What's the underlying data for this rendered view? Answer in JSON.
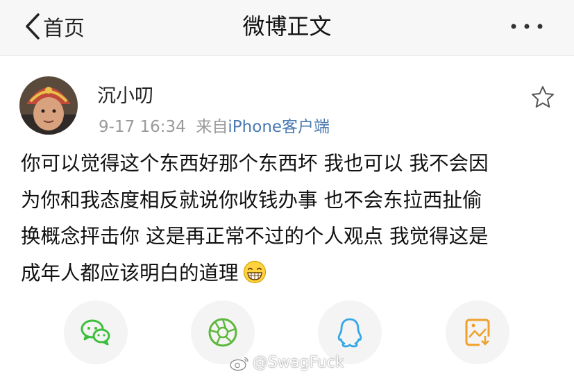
{
  "nav": {
    "back_label": "首页",
    "title": "微博正文"
  },
  "post": {
    "username": "沉小叨",
    "date": "9-17 16:34",
    "source_prefix": "来自",
    "source": "iPhone客户端",
    "lines": [
      "你可以觉得这个东西好那个东西坏 我也可以 我不会因",
      "为你和我态度相反就说你收钱办事 也不会东拉西扯偷",
      "换概念抨击你 这是再正常不过的个人观点 我觉得这是",
      "成年人都应该明白的道理"
    ]
  },
  "share_icons": [
    "wechat-icon",
    "moments-icon",
    "qq-icon",
    "save-image-icon"
  ],
  "watermark": "@SwagFuck",
  "colors": {
    "nav_bg": "#f7f7f7",
    "source_link": "#4a7ab0",
    "meta_gray": "#9a9a9a",
    "wechat": "#3cbf3a",
    "moments": "#5cb83b",
    "qq": "#35a7e6",
    "save": "#f0a02a"
  }
}
